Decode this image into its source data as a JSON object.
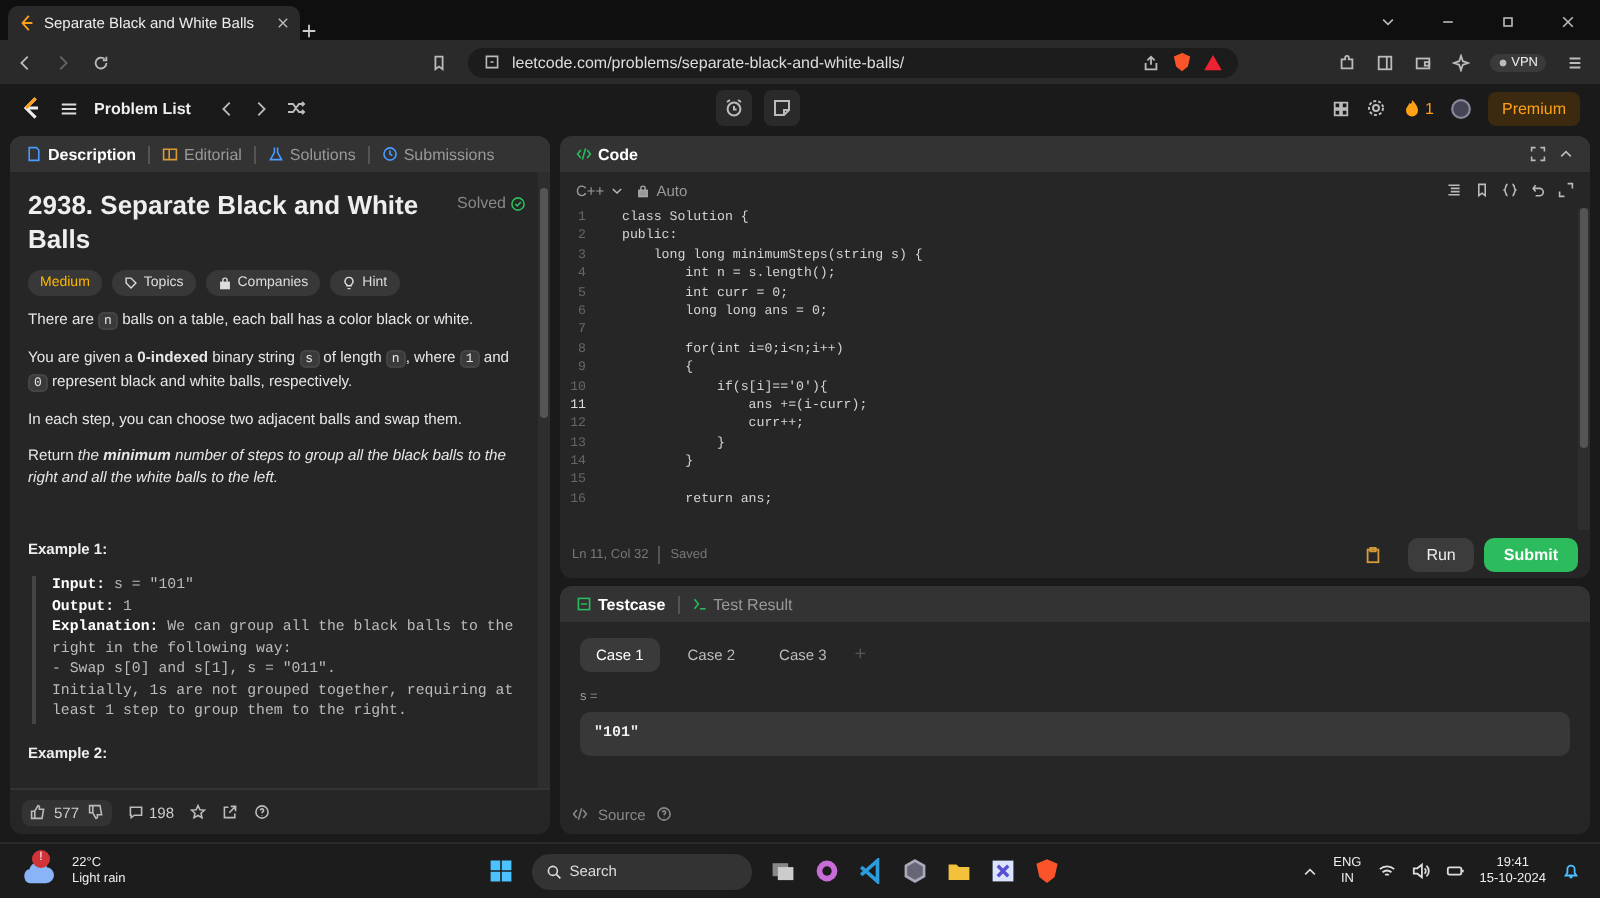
{
  "browser": {
    "tab_title": "Separate Black and White Balls",
    "url": "leetcode.com/problems/separate-black-and-white-balls/",
    "vpn": "VPN"
  },
  "nav": {
    "problem_list": "Problem List",
    "streak": "1",
    "premium": "Premium"
  },
  "description_panel": {
    "tabs": [
      {
        "label": "Description",
        "selected": true
      },
      {
        "label": "Editorial",
        "selected": false
      },
      {
        "label": "Solutions",
        "selected": false
      },
      {
        "label": "Submissions",
        "selected": false
      }
    ],
    "title": "2938. Separate Black and White Balls",
    "status": "Solved",
    "tags": [
      {
        "label": "Medium",
        "kind": "difficulty"
      },
      {
        "label": "Topics",
        "kind": "topics"
      },
      {
        "label": "Companies",
        "kind": "companies"
      },
      {
        "label": "Hint",
        "kind": "hint"
      }
    ],
    "paragraphs": [
      [
        {
          "kind": "text",
          "text": "There are "
        },
        {
          "kind": "code",
          "text": "n"
        },
        {
          "kind": "text",
          "text": " balls on a table, each ball has a color black or white."
        }
      ],
      [
        {
          "kind": "text",
          "text": "You are given a **0-indexed** binary string "
        },
        {
          "kind": "code",
          "text": "s"
        },
        {
          "kind": "text",
          "text": " of length "
        },
        {
          "kind": "code",
          "text": "n"
        },
        {
          "kind": "text",
          "text": ", where "
        },
        {
          "kind": "code",
          "text": "1"
        },
        {
          "kind": "text",
          "text": " and "
        },
        {
          "kind": "code",
          "text": "0"
        },
        {
          "kind": "text",
          "text": " represent black and white balls, respectively."
        }
      ],
      [
        {
          "kind": "text",
          "text": "In each step, you can choose two adjacent balls and swap them."
        }
      ],
      [
        {
          "kind": "text",
          "text": "Return *the* **minimum** *number of steps to group all the black balls to the right and all the white balls to the left.*"
        }
      ]
    ],
    "example": {
      "heading": "Example 1:",
      "lines": [
        "**Input:** s = \"101\"",
        "**Output:** 1",
        "**Explanation:** We can group all the black balls to the right in the following way:",
        "- Swap s[0] and s[1], s = \"011\".",
        "Initially, 1s are not grouped together, requiring at least 1 step to group them to the right."
      ]
    },
    "next_heading": "Example 2:",
    "likes": "577",
    "comments": "198"
  },
  "code_panel": {
    "title": "Code",
    "language": "C++",
    "mode": "Auto",
    "lines": [
      {
        "n": "1",
        "text": "class Solution {",
        "current": false
      },
      {
        "n": "2",
        "text": "public:",
        "current": false
      },
      {
        "n": "3",
        "text": "    long long minimumSteps(string s) {",
        "current": false
      },
      {
        "n": "4",
        "text": "        int n = s.length();",
        "current": false
      },
      {
        "n": "5",
        "text": "        int curr = 0;",
        "current": false
      },
      {
        "n": "6",
        "text": "        long long ans = 0;",
        "current": false
      },
      {
        "n": "7",
        "current": false
      },
      {
        "n": "8",
        "text": "        for(int i=0;i<n;i++)",
        "current": false
      },
      {
        "n": "9",
        "text": "        {",
        "current": false
      },
      {
        "n": "10",
        "text": "            if(s[i]=='0'){",
        "current": false
      },
      {
        "n": "11",
        "text": "                ans +=(i-curr);",
        "current": true
      },
      {
        "n": "12",
        "text": "                curr++;",
        "current": false
      },
      {
        "n": "13",
        "text": "            }",
        "current": false
      },
      {
        "n": "14",
        "text": "        }",
        "current": false
      },
      {
        "n": "15",
        "current": false
      },
      {
        "n": "16",
        "text": "        return ans;",
        "current": false
      }
    ],
    "cursor": "Ln 11, Col 32",
    "save_state": "Saved",
    "run": "Run",
    "submit": "Submit"
  },
  "test_panel": {
    "tabs": [
      {
        "label": "Testcase",
        "selected": true
      },
      {
        "label": "Test Result",
        "selected": false
      }
    ],
    "cases": [
      {
        "label": "Case 1",
        "selected": true
      },
      {
        "label": "Case 2",
        "selected": false
      },
      {
        "label": "Case 3",
        "selected": false
      }
    ],
    "add": "+",
    "param": "s =",
    "value": "\"101\"",
    "source": "Source"
  },
  "taskbar": {
    "temperature": "22°C",
    "weather": "Light rain",
    "alert": "!",
    "search": "Search",
    "lang": "ENG",
    "region": "IN",
    "time": "19:41",
    "date": "15-10-2024"
  }
}
